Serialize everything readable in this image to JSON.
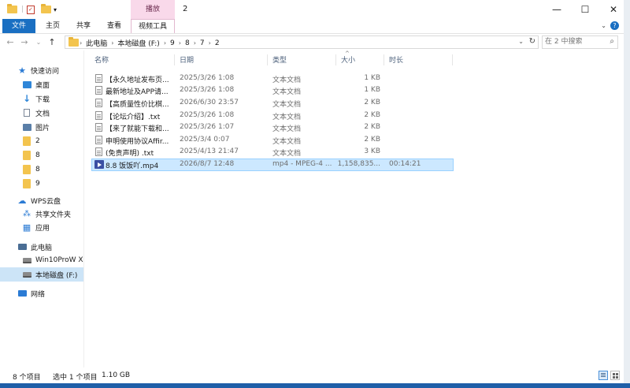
{
  "window": {
    "title": "2",
    "context_tab": "播放",
    "controls": {
      "minimize": "—",
      "maximize": "☐",
      "close": "✕"
    }
  },
  "ribbon": {
    "tabs": [
      {
        "label": "文件",
        "kind": "file"
      },
      {
        "label": "主页"
      },
      {
        "label": "共享"
      },
      {
        "label": "查看"
      },
      {
        "label": "视频工具",
        "active": true
      }
    ],
    "collapse_glyph": "⌄",
    "help_glyph": "?"
  },
  "address": {
    "crumbs": [
      "此电脑",
      "本地磁盘 (F:)",
      "9",
      "8",
      "7",
      "2"
    ],
    "search_placeholder": "在 2 中搜索"
  },
  "nav": {
    "items": [
      {
        "label": "快速访问",
        "icon": "star-icon",
        "color": "#2b7bd4"
      },
      {
        "label": "桌面",
        "icon": "desktop-icon",
        "color": "#2f86d8",
        "pinned": true
      },
      {
        "label": "下载",
        "icon": "download-icon",
        "color": "#2f86d8",
        "pinned": true
      },
      {
        "label": "文档",
        "icon": "document-icon",
        "color": "#7a8696",
        "pinned": true
      },
      {
        "label": "图片",
        "icon": "pictures-icon",
        "color": "#5a7fa8",
        "pinned": true
      },
      {
        "label": "2",
        "icon": "folder-icon"
      },
      {
        "label": "8",
        "icon": "folder-icon"
      },
      {
        "label": "8",
        "icon": "folder-icon"
      },
      {
        "label": "9",
        "icon": "folder-icon"
      },
      {
        "label": "WPS云盘",
        "icon": "cloud-icon",
        "color": "#2b7bd4"
      },
      {
        "label": "共享文件夹",
        "icon": "shared-folder-icon",
        "color": "#2b7bd4"
      },
      {
        "label": "应用",
        "icon": "apps-icon",
        "color": "#2b7bd4"
      },
      {
        "label": "此电脑",
        "icon": "computer-icon",
        "color": "#4a6d94"
      },
      {
        "label": "Win10ProW X",
        "icon": "drive-icon"
      },
      {
        "label": "本地磁盘 (F:)",
        "icon": "drive-icon",
        "selected": true
      },
      {
        "label": "网络",
        "icon": "network-icon",
        "color": "#2b7bd4"
      }
    ],
    "pin_glyph": "📌"
  },
  "columns": {
    "name": "名称",
    "date": "日期",
    "type": "类型",
    "size": "大小",
    "duration": "时长"
  },
  "files": [
    {
      "name": "【永久地址发布页...",
      "date": "2025/3/26 1:08",
      "type": "文本文档",
      "size": "1 KB",
      "duration": "",
      "icon": "text-file-icon"
    },
    {
      "name": "最新地址及APP请...",
      "date": "2025/3/26 1:08",
      "type": "文本文档",
      "size": "1 KB",
      "duration": "",
      "icon": "text-file-icon"
    },
    {
      "name": "【高质量性价比棋...",
      "date": "2026/6/30 23:57",
      "type": "文本文档",
      "size": "2 KB",
      "duration": "",
      "icon": "text-file-icon"
    },
    {
      "name": "【论坛介绍】.txt",
      "date": "2025/3/26 1:08",
      "type": "文本文档",
      "size": "2 KB",
      "duration": "",
      "icon": "text-file-icon"
    },
    {
      "name": "【来了就能下载和...",
      "date": "2025/3/26 1:07",
      "type": "文本文档",
      "size": "2 KB",
      "duration": "",
      "icon": "text-file-icon"
    },
    {
      "name": "申明使用协议Affir...",
      "date": "2025/3/4 0:07",
      "type": "文本文档",
      "size": "2 KB",
      "duration": "",
      "icon": "text-file-icon"
    },
    {
      "name": "(免责声明) .txt",
      "date": "2025/4/13 21:47",
      "type": "文本文档",
      "size": "3 KB",
      "duration": "",
      "icon": "text-file-icon"
    },
    {
      "name": "8.8 饭饭吖.mp4",
      "date": "2026/8/7 12:48",
      "type": "mp4 - MPEG-4 ...",
      "size": "1,158,835...",
      "duration": "00:14:21",
      "icon": "video-file-icon",
      "selected": true
    }
  ],
  "status": {
    "item_count": "8 个项目",
    "selection": "选中 1 个项目",
    "selection_size": "1.10 GB"
  },
  "colors": {
    "accent": "#1a6fc2",
    "selection": "#cce8ff",
    "context_tab": "#f9d9ea",
    "folder": "#f3c44e"
  }
}
